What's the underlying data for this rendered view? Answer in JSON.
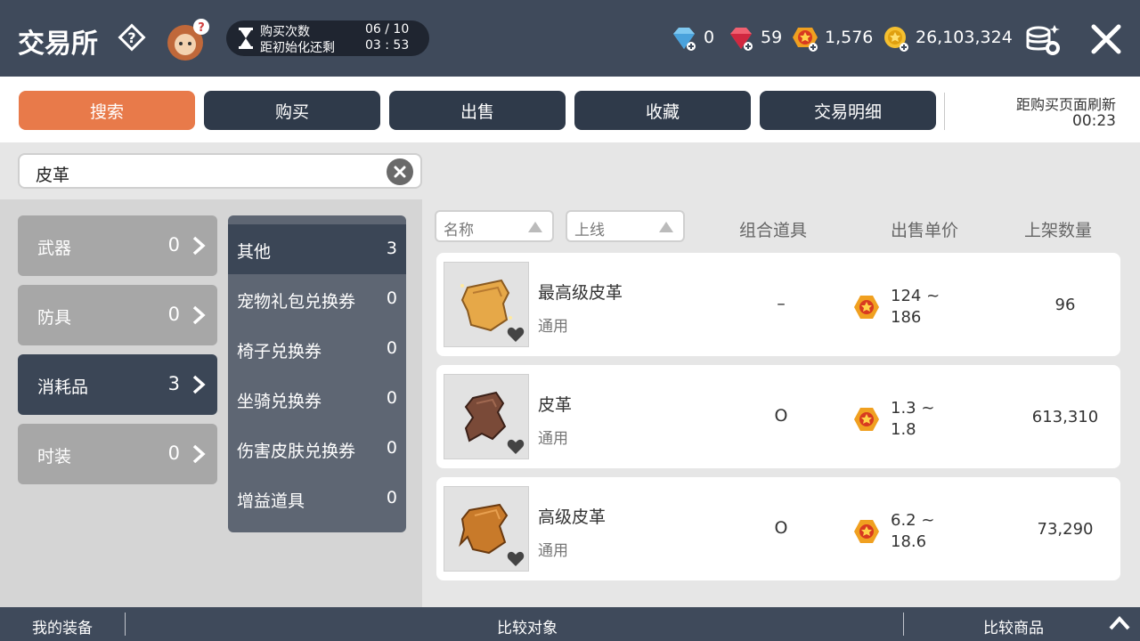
{
  "header": {
    "title": "交易所",
    "timer": {
      "label1": "购买次数",
      "value1": "06 / 10",
      "label2": "距初始化还剩",
      "value2": "03 : 53"
    },
    "currencies": [
      {
        "icon": "diamond-icon",
        "value": "0"
      },
      {
        "icon": "ruby-icon",
        "value": "59"
      },
      {
        "icon": "medal-coin-icon",
        "value": "1,576"
      },
      {
        "icon": "gold-coin-icon",
        "value": "26,103,324"
      }
    ]
  },
  "tabs": [
    {
      "label": "搜索",
      "active": true
    },
    {
      "label": "购买",
      "active": false
    },
    {
      "label": "出售",
      "active": false
    },
    {
      "label": "收藏",
      "active": false
    },
    {
      "label": "交易明细",
      "active": false
    }
  ],
  "refresh": {
    "label": "距购买页面刷新",
    "time": "00:23"
  },
  "search": {
    "value": "皮革"
  },
  "categories": [
    {
      "label": "武器",
      "count": "0",
      "active": false
    },
    {
      "label": "防具",
      "count": "0",
      "active": false
    },
    {
      "label": "消耗品",
      "count": "3",
      "active": true
    },
    {
      "label": "时装",
      "count": "0",
      "active": false
    }
  ],
  "subcategories": [
    {
      "label": "其他",
      "count": "3",
      "active": true
    },
    {
      "label": "宠物礼包兑换券",
      "count": "0",
      "active": false
    },
    {
      "label": "椅子兑换券",
      "count": "0",
      "active": false
    },
    {
      "label": "坐骑兑换券",
      "count": "0",
      "active": false
    },
    {
      "label": "伤害皮肤兑换券",
      "count": "0",
      "active": false
    },
    {
      "label": "增益道具",
      "count": "0",
      "active": false
    }
  ],
  "sort": {
    "name_label": "名称",
    "date_label": "上线"
  },
  "columns": {
    "combo": "组合道具",
    "price": "出售单价",
    "qty": "上架数量"
  },
  "items": [
    {
      "name": "最高级皮革",
      "type": "通用",
      "combo": "–",
      "price_min": "124 ~",
      "price_max": "186",
      "qty": "96",
      "color": "#e0a040"
    },
    {
      "name": "皮革",
      "type": "通用",
      "combo": "O",
      "price_min": "1.3 ~",
      "price_max": "1.8",
      "qty": "613,310",
      "color": "#7a4a38"
    },
    {
      "name": "高级皮革",
      "type": "通用",
      "combo": "O",
      "price_min": "6.2 ~",
      "price_max": "18.6",
      "qty": "73,290",
      "color": "#c87a2a"
    }
  ],
  "footer": {
    "left": "我的装备",
    "middle": "比较对象",
    "right": "比较商品"
  },
  "colors": {
    "accent": "#e87a4a",
    "header": "#3f4a5b",
    "dark_tab": "#2f3a4a"
  }
}
